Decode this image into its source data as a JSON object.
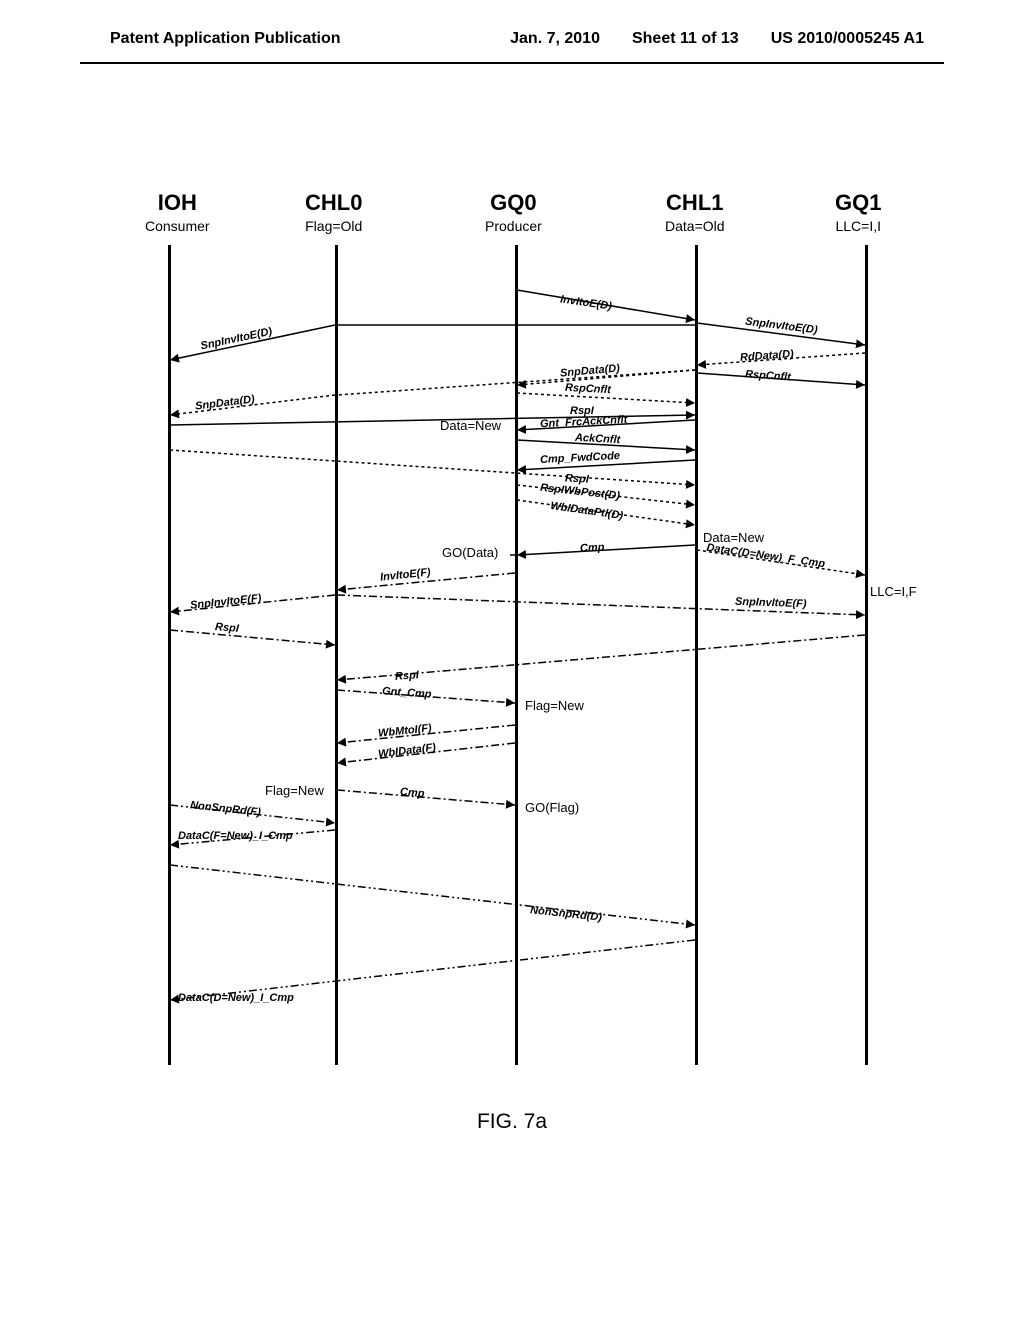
{
  "header": {
    "left": "Patent Application Publication",
    "date": "Jan. 7, 2010",
    "sheet": "Sheet 11 of 13",
    "pubno": "US 2010/0005245 A1"
  },
  "actors": {
    "ioh": {
      "title": "IOH",
      "sub": "Consumer"
    },
    "chl0": {
      "title": "CHL0",
      "sub": "Flag=Old"
    },
    "gq0": {
      "title": "GQ0",
      "sub": "Producer"
    },
    "chl1": {
      "title": "CHL1",
      "sub": "Data=Old"
    },
    "gq1": {
      "title": "GQ1",
      "sub": "LLC=I,I"
    }
  },
  "messages": {
    "invitoe_d": "InvItoE(D)",
    "snpinvitoe_d": "SnpInvItoE(D)",
    "snpinvitoe_d2": "SnpInvItoE(D)",
    "rddata_d": "RdData(D)",
    "snpdata_d": "SnpData(D)",
    "rspcnflt": "RspCnflt",
    "rspcnflt2": "RspCnflt",
    "snpdata_d2": "SnpData(D)",
    "rspi": "RspI",
    "gnt_frcackcnflt": "Gnt_FrcAckCnflt",
    "ackcnflt": "AckCnflt",
    "cmp_fwdcode": "Cmp_FwdCode",
    "rspi2": "RspI",
    "rspiwbpost_d": "RspIWbPost(D)",
    "wbidataptl_d": "WbIDataPtl(D)",
    "cmp": "Cmp",
    "datac_dnew_f_cmp": "DataC(D=New)_F_Cmp",
    "invitoe_f": "InvItoE(F)",
    "snpinvitoe_f": "SnpInvItoE(F)",
    "snpinvitoe_f2": "SnpInvItoE(F)",
    "rspi3": "RspI",
    "rspi4": "RspI",
    "gnt_cmp": "Gnt_Cmp",
    "wbmtoi_f": "WbMtoI(F)",
    "wbidata_f": "WbIData(F)",
    "cmp2": "Cmp",
    "go_data": "GO(Data)",
    "go_flag": "GO(Flag)",
    "nonsnprd_f": "NonSnpRd(F)",
    "datac_fnew_i_cmp": "DataC(F=New)_I_Cmp",
    "nonsnprd_d": "NonSnpRd(D)",
    "datac_dnew_i_cmp": "DataC(D=New)_I_Cmp"
  },
  "states": {
    "data_new": "Data=New",
    "data_new2": "Data=New",
    "llc_if": "LLC=I,F",
    "flag_new": "Flag=New",
    "flag_new2": "Flag=New"
  },
  "caption": "FIG. 7a"
}
